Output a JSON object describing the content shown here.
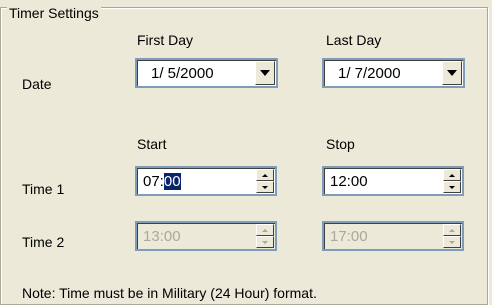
{
  "group": {
    "title": "Timer Settings"
  },
  "headers": {
    "first_day": "First Day",
    "last_day": "Last Day",
    "start": "Start",
    "stop": "Stop"
  },
  "rows": {
    "date_label": "Date",
    "time1_label": "Time 1",
    "time2_label": "Time 2"
  },
  "date": {
    "first_day_value": "1/ 5/2000",
    "last_day_value": "1/ 7/2000"
  },
  "time1": {
    "start_prefix": "07:",
    "start_selected": "00",
    "stop_value": "12:00"
  },
  "time2": {
    "start_value": "13:00",
    "stop_value": "17:00",
    "enabled": false
  },
  "note": "Note: Time must be in Military (24 Hour) format.",
  "icons": [
    "chevron-down-icon",
    "spin-up-icon",
    "spin-down-icon"
  ],
  "colors": {
    "background": "#ece9d8",
    "selection": "#0a246a",
    "disabled_text": "#aca899"
  }
}
